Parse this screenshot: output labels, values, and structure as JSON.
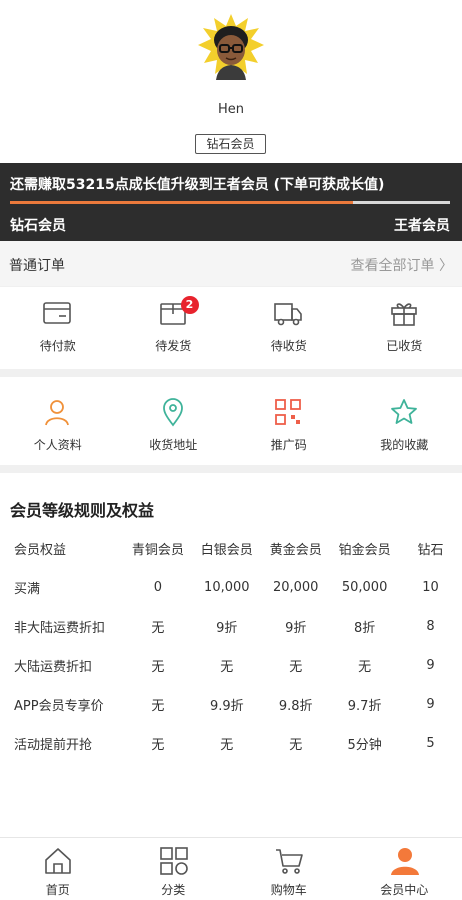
{
  "profile": {
    "username": "Hen",
    "level": "钻石会员"
  },
  "upgrade": {
    "message": "还需赚取53215点成长值升级到王者会员 (下单可获成长值)",
    "current_level": "钻石会员",
    "next_level": "王者会员",
    "progress": 0.78
  },
  "orders": {
    "title": "普通订单",
    "view_all": "查看全部订单 〉",
    "items": [
      {
        "label": "待付款",
        "icon": "wallet-icon"
      },
      {
        "label": "待发货",
        "icon": "package-icon",
        "badge": "2"
      },
      {
        "label": "待收货",
        "icon": "truck-icon"
      },
      {
        "label": "已收货",
        "icon": "gift-icon"
      }
    ]
  },
  "tools": {
    "items": [
      {
        "label": "个人资料",
        "icon": "person-icon"
      },
      {
        "label": "收货地址",
        "icon": "location-icon"
      },
      {
        "label": "推广码",
        "icon": "qrcode-icon"
      },
      {
        "label": "我的收藏",
        "icon": "star-icon"
      }
    ]
  },
  "rules": {
    "title": "会员等级规则及权益",
    "headers": [
      "会员权益",
      "青铜会员",
      "白银会员",
      "黄金会员",
      "铂金会员",
      "钻石"
    ],
    "rows": [
      [
        "买满",
        "0",
        "10,000",
        "20,000",
        "50,000",
        "10"
      ],
      [
        "非大陆运费折扣",
        "无",
        "9折",
        "9折",
        "8折",
        "8"
      ],
      [
        "大陆运费折扣",
        "无",
        "无",
        "无",
        "无",
        "9"
      ],
      [
        "APP会员专享价",
        "无",
        "9.9折",
        "9.8折",
        "9.7折",
        "9"
      ],
      [
        "活动提前开抢",
        "无",
        "无",
        "无",
        "5分钟",
        "5"
      ]
    ]
  },
  "nav": {
    "items": [
      {
        "label": "首页",
        "icon": "home-icon"
      },
      {
        "label": "分类",
        "icon": "category-icon"
      },
      {
        "label": "购物车",
        "icon": "cart-icon"
      },
      {
        "label": "会员中心",
        "icon": "member-icon",
        "active": true
      }
    ]
  },
  "colors": {
    "accent": "#ec7a3c",
    "dark_bar": "#2d2d2d",
    "badge_red": "#e8232e",
    "icon_orange": "#f0913a",
    "icon_teal": "#3fb39a",
    "icon_red": "#ee5f4a"
  }
}
